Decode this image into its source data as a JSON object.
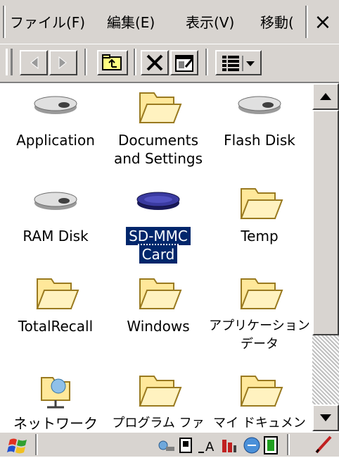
{
  "menu": {
    "items": [
      "ファイル(F)",
      "編集(E)",
      "表示(V)",
      "移動("
    ],
    "close": "×"
  },
  "toolbar": {
    "buttons": [
      "back-icon",
      "forward-icon",
      "up-folder-icon",
      "delete-icon",
      "properties-icon",
      "view-menu-icon"
    ]
  },
  "files": [
    {
      "label_line1": "Application",
      "label_line2": "",
      "icon": "disk-icon"
    },
    {
      "label_line1": "Documents",
      "label_line2": "and Settings",
      "icon": "folder-icon"
    },
    {
      "label_line1": "Flash Disk",
      "label_line2": "",
      "icon": "disk-icon"
    },
    {
      "label_line1": "RAM Disk",
      "label_line2": "",
      "icon": "disk-icon"
    },
    {
      "label_line1": "SD-MMC",
      "label_line2": "Card",
      "icon": "sd-card-icon",
      "selected": true
    },
    {
      "label_line1": "Temp",
      "label_line2": "",
      "icon": "folder-icon"
    },
    {
      "label_line1": "TotalRecall",
      "label_line2": "",
      "icon": "folder-icon"
    },
    {
      "label_line1": "Windows",
      "label_line2": "",
      "icon": "folder-icon"
    },
    {
      "label_line1": "アプリケーション",
      "label_line2": "データ",
      "icon": "folder-icon"
    },
    {
      "label_line1": "ネットワーク",
      "label_line2": "",
      "icon": "network-folder-icon"
    },
    {
      "label_line1": "プログラム ファ",
      "label_line2": "",
      "icon": "folder-icon"
    },
    {
      "label_line1": "マイ ドキュメン",
      "label_line2": "",
      "icon": "folder-icon"
    }
  ],
  "taskbar": {
    "start_icon": "windows-flag-icon",
    "tray_icons": [
      "network-icon",
      "input-panel-icon",
      "font-icon",
      "battery-status-icon",
      "connection-icon",
      "battery-icon",
      "pen-icon"
    ]
  }
}
